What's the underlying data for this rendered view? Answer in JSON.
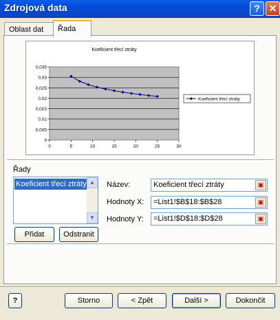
{
  "window": {
    "title": "Zdrojová data",
    "help_label": "?",
    "close_label": "✕"
  },
  "tabs": [
    {
      "label": "Oblast dat"
    },
    {
      "label": "Řada"
    }
  ],
  "chart_data": {
    "type": "line",
    "title": "Koeficient třecí ztráty",
    "x": [
      5,
      7,
      9,
      11,
      13,
      15,
      17,
      19,
      21,
      23,
      25
    ],
    "series": [
      {
        "name": "Koeficient třecí ztráty",
        "values": [
          0.0305,
          0.0281,
          0.0265,
          0.0253,
          0.0244,
          0.0236,
          0.0229,
          0.0223,
          0.0218,
          0.0213,
          0.0209
        ]
      }
    ],
    "xlim": [
      0,
      30
    ],
    "ylim": [
      0,
      0.035
    ],
    "xticks": [
      "0",
      "5",
      "10",
      "15",
      "20",
      "25",
      "30"
    ],
    "yticks": [
      "0",
      "0,005",
      "0,01",
      "0,015",
      "0,02",
      "0,025",
      "0,03",
      "0,035"
    ],
    "grid": true,
    "legend": "right",
    "plot_bg": "#c0c0c0",
    "line_color": "#000080"
  },
  "series_section": {
    "label": "Řady",
    "items": [
      "Koeficient třecí ztráty"
    ],
    "add_button": "Přidat",
    "remove_button": "Odstranit"
  },
  "fields": {
    "name_label": "Název:",
    "name_value": "Koeficient třecí ztráty",
    "x_label": "Hodnoty X:",
    "x_value": "=List1!$B$18:$B$28",
    "y_label": "Hodnoty Y:",
    "y_value": "=List1!$D$18:$D$28"
  },
  "footer": {
    "help_icon_label": "?",
    "cancel": "Storno",
    "back": "< Zpět",
    "next": "Další >",
    "finish": "Dokončit"
  }
}
